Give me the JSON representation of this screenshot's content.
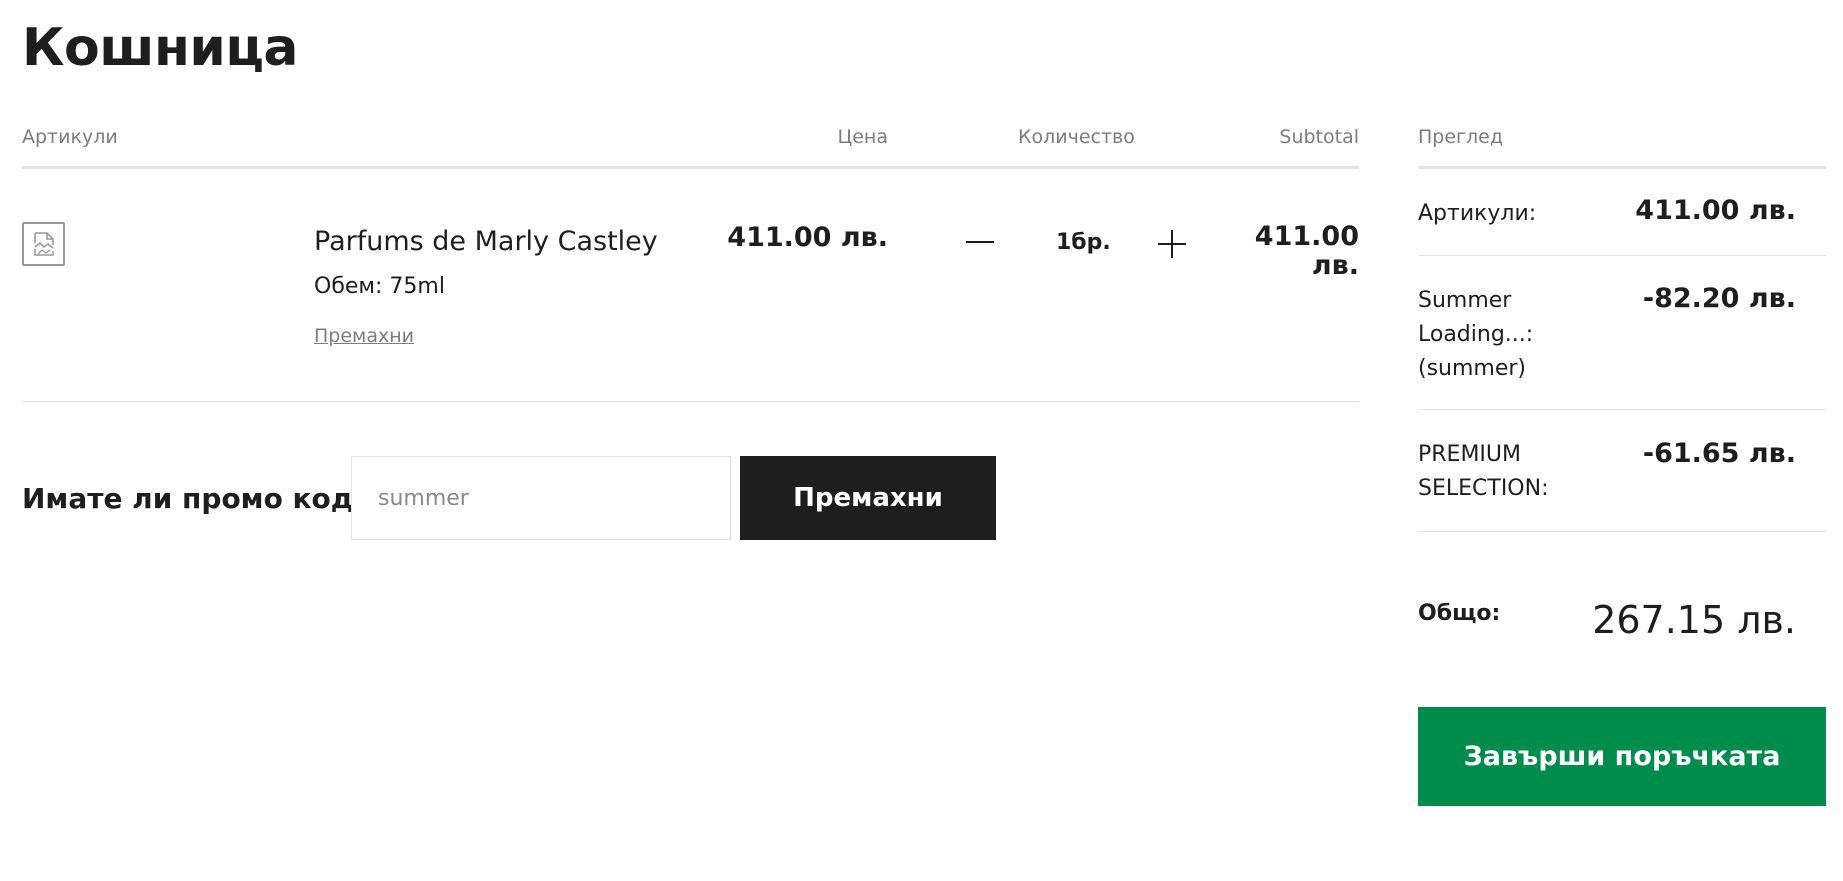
{
  "page": {
    "title": "Кошница"
  },
  "table": {
    "headers": {
      "items": "Артикули",
      "price": "Цена",
      "quantity": "Количество",
      "subtotal": "Subtotal"
    }
  },
  "cart": {
    "items": [
      {
        "image_icon": "broken-image-icon",
        "name": "Parfums de Marly Castley",
        "volume": "Обем: 75ml",
        "remove_label": "Премахни",
        "price": "411.00 лв.",
        "quantity": "1бр.",
        "subtotal": "411.00 лв."
      }
    ]
  },
  "promo": {
    "label": "Имате ли промо код",
    "placeholder": "summer",
    "button_label": "Премахни"
  },
  "summary": {
    "title": "Преглед",
    "lines": [
      {
        "label": "Артикули:",
        "value": "411.00 лв."
      },
      {
        "label": "Summer Loading...: (summer)",
        "value": "-82.20 лв."
      },
      {
        "label": "PREMIUM SELECTION:",
        "value": "-61.65 лв."
      }
    ],
    "total_label": "Общо:",
    "total_value": "267.15 лв.",
    "checkout_label": "Завърши поръчката"
  },
  "colors": {
    "checkout": "#008c4a",
    "dark_button": "#1e1e1e",
    "muted_text": "#7d7d7d",
    "divider": "#e3e3e3"
  }
}
